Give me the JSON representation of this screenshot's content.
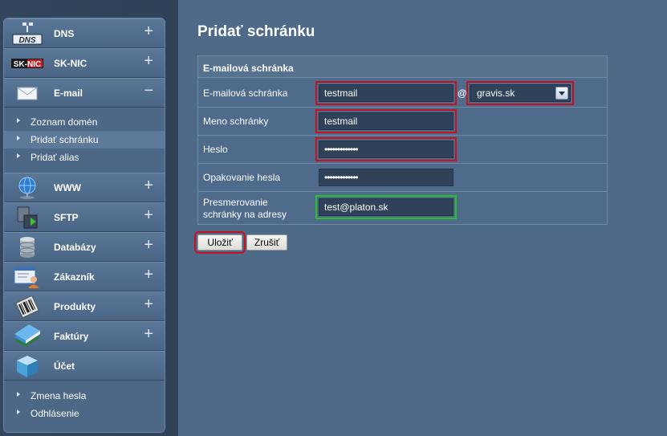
{
  "sidebar": {
    "items": [
      {
        "label": "DNS",
        "toggle": "+",
        "icon": "dns-icon"
      },
      {
        "label": "SK-NIC",
        "toggle": "+",
        "icon": "sknic-icon"
      },
      {
        "label": "E-mail",
        "toggle": "−",
        "icon": "envelope-icon"
      },
      {
        "label": "WWW",
        "toggle": "+",
        "icon": "globe-icon"
      },
      {
        "label": "SFTP",
        "toggle": "+",
        "icon": "sftp-icon"
      },
      {
        "label": "Databázy",
        "toggle": "+",
        "icon": "database-icon"
      },
      {
        "label": "Zákazník",
        "toggle": "+",
        "icon": "customer-icon"
      },
      {
        "label": "Produkty",
        "toggle": "+",
        "icon": "barcode-icon"
      },
      {
        "label": "Faktúry",
        "toggle": "+",
        "icon": "books-icon"
      },
      {
        "label": "Účet",
        "toggle": "",
        "icon": "cube-icon"
      }
    ],
    "email_sub": [
      "Zoznam domén",
      "Pridať schránku",
      "Pridať alias"
    ],
    "account_sub": [
      "Zmena hesla",
      "Odhlásenie"
    ],
    "icon_texts": {
      "dns": "DNS",
      "sknic": "SK-NIC"
    }
  },
  "page": {
    "title": "Pridať schránku",
    "panel_title": "E-mailová schránka"
  },
  "form": {
    "mailbox_label": "E-mailová schránka",
    "mailbox_value": "testmail",
    "at_sign": "@",
    "domain_value": "gravis.sk",
    "name_label": "Meno schránky",
    "name_value": "testmail",
    "password_label": "Heslo",
    "password_value": "•••••••••••••",
    "repeat_label": "Opakovanie hesla",
    "repeat_value": "•••••••••••••",
    "redirect_label_1": "Presmerovanie",
    "redirect_label_2": "schránky na adresy",
    "redirect_value": "test@platon.sk"
  },
  "buttons": {
    "save": "Uložiť",
    "cancel": "Zrušiť"
  },
  "colors": {
    "highlight_red": "#c8101e",
    "highlight_green": "#27c224",
    "background": "#4e6a88"
  }
}
